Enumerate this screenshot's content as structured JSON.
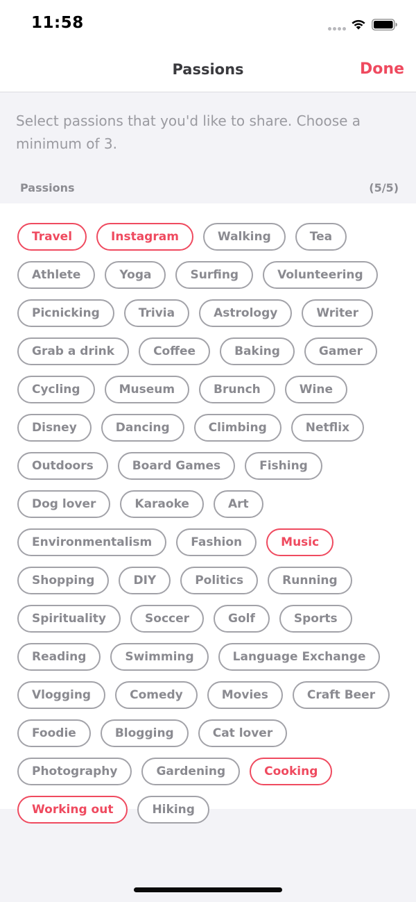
{
  "status_bar": {
    "time": "11:58",
    "icons": [
      "signal-dots-icon",
      "wifi-icon",
      "battery-icon"
    ]
  },
  "nav": {
    "title": "Passions",
    "done_label": "Done"
  },
  "description": "Select passions that you'd like to share. Choose a minimum of 3.",
  "section": {
    "title": "Passions",
    "count": "(5/5)"
  },
  "colors": {
    "accent": "#ef4a5f",
    "chip_border": "#a2a2a8",
    "chip_text": "#8a8a90",
    "background": "#f3f3f7"
  },
  "passions": [
    {
      "label": "Travel",
      "selected": true
    },
    {
      "label": "Instagram",
      "selected": true
    },
    {
      "label": "Walking",
      "selected": false
    },
    {
      "label": "Tea",
      "selected": false
    },
    {
      "label": "Athlete",
      "selected": false
    },
    {
      "label": "Yoga",
      "selected": false
    },
    {
      "label": "Surfing",
      "selected": false
    },
    {
      "label": "Volunteering",
      "selected": false
    },
    {
      "label": "Picnicking",
      "selected": false
    },
    {
      "label": "Trivia",
      "selected": false
    },
    {
      "label": "Astrology",
      "selected": false
    },
    {
      "label": "Writer",
      "selected": false
    },
    {
      "label": "Grab a drink",
      "selected": false
    },
    {
      "label": "Coffee",
      "selected": false
    },
    {
      "label": "Baking",
      "selected": false
    },
    {
      "label": "Gamer",
      "selected": false
    },
    {
      "label": "Cycling",
      "selected": false
    },
    {
      "label": "Museum",
      "selected": false
    },
    {
      "label": "Brunch",
      "selected": false
    },
    {
      "label": "Wine",
      "selected": false
    },
    {
      "label": "Disney",
      "selected": false
    },
    {
      "label": "Dancing",
      "selected": false
    },
    {
      "label": "Climbing",
      "selected": false
    },
    {
      "label": "Netflix",
      "selected": false
    },
    {
      "label": "Outdoors",
      "selected": false
    },
    {
      "label": "Board Games",
      "selected": false
    },
    {
      "label": "Fishing",
      "selected": false
    },
    {
      "label": "Dog lover",
      "selected": false
    },
    {
      "label": "Karaoke",
      "selected": false
    },
    {
      "label": "Art",
      "selected": false
    },
    {
      "label": "Environmentalism",
      "selected": false
    },
    {
      "label": "Fashion",
      "selected": false
    },
    {
      "label": "Music",
      "selected": true
    },
    {
      "label": "Shopping",
      "selected": false
    },
    {
      "label": "DIY",
      "selected": false
    },
    {
      "label": "Politics",
      "selected": false
    },
    {
      "label": "Running",
      "selected": false
    },
    {
      "label": "Spirituality",
      "selected": false
    },
    {
      "label": "Soccer",
      "selected": false
    },
    {
      "label": "Golf",
      "selected": false
    },
    {
      "label": "Sports",
      "selected": false
    },
    {
      "label": "Reading",
      "selected": false
    },
    {
      "label": "Swimming",
      "selected": false
    },
    {
      "label": "Language Exchange",
      "selected": false
    },
    {
      "label": "Vlogging",
      "selected": false
    },
    {
      "label": "Comedy",
      "selected": false
    },
    {
      "label": "Movies",
      "selected": false
    },
    {
      "label": "Craft Beer",
      "selected": false
    },
    {
      "label": "Foodie",
      "selected": false
    },
    {
      "label": "Blogging",
      "selected": false
    },
    {
      "label": "Cat lover",
      "selected": false
    },
    {
      "label": "Photography",
      "selected": false
    },
    {
      "label": "Gardening",
      "selected": false
    },
    {
      "label": "Cooking",
      "selected": true
    },
    {
      "label": "Working out",
      "selected": true
    },
    {
      "label": "Hiking",
      "selected": false
    }
  ]
}
